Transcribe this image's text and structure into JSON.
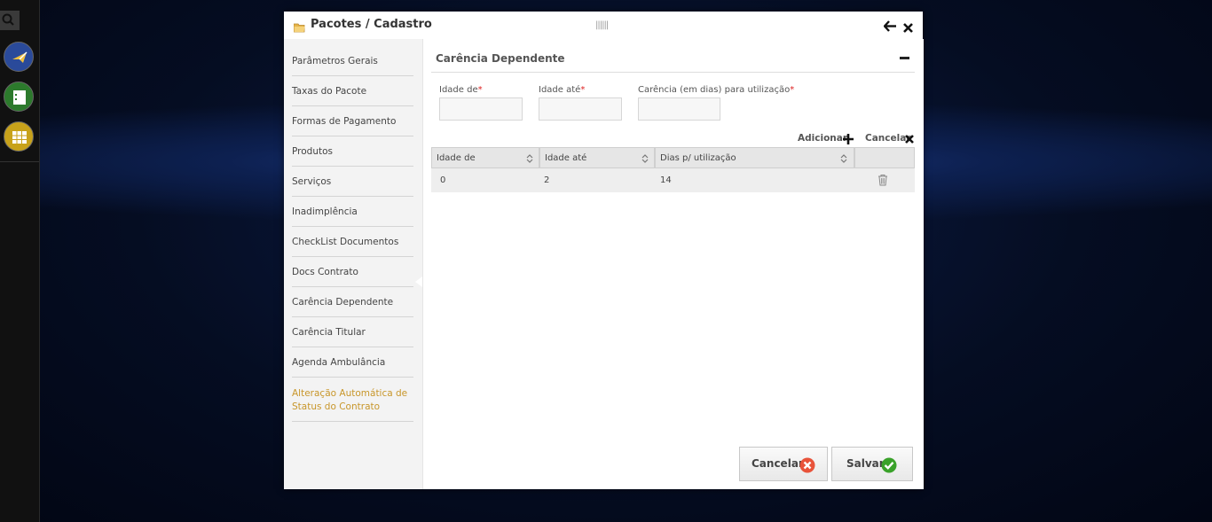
{
  "launcher": {
    "apps": [
      {
        "icon": "plane-icon",
        "color": "#2a4a9a"
      },
      {
        "icon": "list-icon",
        "color": "#2c7a2c"
      },
      {
        "icon": "grid-icon",
        "color": "#c8a21a"
      }
    ]
  },
  "dialog": {
    "title": "Pacotes / Cadastro",
    "grip": "||||||"
  },
  "menu": {
    "items": [
      {
        "label": "Parâmetros Gerais"
      },
      {
        "label": "Taxas do Pacote"
      },
      {
        "label": "Formas de Pagamento"
      },
      {
        "label": "Produtos"
      },
      {
        "label": "Serviços"
      },
      {
        "label": "Inadimplência"
      },
      {
        "label": "CheckList Documentos"
      },
      {
        "label": "Docs Contrato"
      },
      {
        "label": "Carência Dependente"
      },
      {
        "label": "Carência Titular"
      },
      {
        "label": "Agenda Ambulância"
      },
      {
        "label": "Alteração Automática de Status do Contrato"
      }
    ],
    "active_color": "#c8962a"
  },
  "section": {
    "title": "Carência Dependente",
    "fields": {
      "idade_de": {
        "label": "Idade de",
        "value": ""
      },
      "idade_ate": {
        "label": "Idade até",
        "value": ""
      },
      "carencia": {
        "label": "Carência (em dias) para utilização",
        "value": ""
      }
    },
    "required_mark": "*",
    "add_label": "Adicionar",
    "cancel_label": "Cancelar"
  },
  "table": {
    "columns": [
      "Idade de",
      "Idade até",
      "Dias p/ utilização",
      ""
    ],
    "rows": [
      {
        "idade_de": "0",
        "idade_ate": "2",
        "dias": "14"
      }
    ]
  },
  "footer": {
    "cancel_label": "Cancelar",
    "save_label": "Salvar",
    "cancel_color": "#e8533a",
    "save_color": "#3aa22a"
  }
}
